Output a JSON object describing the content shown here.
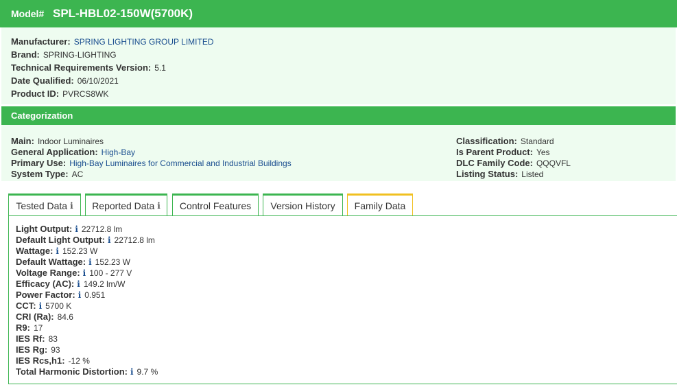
{
  "header": {
    "model_label": "Model#",
    "model_value": "SPL-HBL02-150W(5700K)"
  },
  "info": {
    "manufacturer_label": "Manufacturer:",
    "manufacturer_value": "SPRING LIGHTING GROUP LIMITED",
    "brand_label": "Brand:",
    "brand_value": "SPRING-LIGHTING",
    "tech_label": "Technical Requirements Version:",
    "tech_value": "5.1",
    "date_label": "Date Qualified:",
    "date_value": "06/10/2021",
    "pid_label": "Product ID:",
    "pid_value": "PVRCS8WK"
  },
  "categorization": {
    "title": "Categorization",
    "main_label": "Main:",
    "main_value": "Indoor Luminaires",
    "genapp_label": "General Application:",
    "genapp_value": "High-Bay",
    "primary_label": "Primary Use:",
    "primary_value": "High-Bay Luminaires for Commercial and Industrial Buildings",
    "system_label": "System Type:",
    "system_value": "AC",
    "class_label": "Classification:",
    "class_value": "Standard",
    "parent_label": "Is Parent Product:",
    "parent_value": "Yes",
    "family_label": "DLC Family Code:",
    "family_value": "QQQVFL",
    "status_label": "Listing Status:",
    "status_value": "Listed"
  },
  "tabs": [
    {
      "label": "Tested Data",
      "info": "i"
    },
    {
      "label": "Reported Data",
      "info": "i"
    },
    {
      "label": "Control Features"
    },
    {
      "label": "Version History"
    },
    {
      "label": "Family Data"
    }
  ],
  "info_glyph": "i",
  "reported": [
    {
      "label": "Light Output:",
      "value": "22712.8 lm"
    },
    {
      "label": "Default Light Output:",
      "value": "22712.8 lm"
    },
    {
      "label": "Wattage:",
      "value": "152.23 W"
    },
    {
      "label": "Default Wattage:",
      "value": "152.23 W"
    },
    {
      "label": "Voltage Range:",
      "value": "100 - 277 V"
    },
    {
      "label": "Efficacy (AC):",
      "value": "149.2 lm/W"
    },
    {
      "label": "Power Factor:",
      "value": "0.951"
    },
    {
      "label": "CCT:",
      "value": "5700 K"
    },
    {
      "label": "CRI (Ra):",
      "value": "84.6"
    },
    {
      "label": "R9:",
      "value": "17"
    },
    {
      "label": "IES Rf:",
      "value": "83"
    },
    {
      "label": "IES Rg:",
      "value": "93"
    },
    {
      "label": "IES Rcs,h1:",
      "value": "-12 %"
    },
    {
      "label": "Total Harmonic Distortion:",
      "value": "9.7 %"
    }
  ],
  "colors": {
    "green": "#3cb550",
    "panel": "#eefcf0",
    "link": "#1a4e8f",
    "family_tab": "#f0c020"
  }
}
